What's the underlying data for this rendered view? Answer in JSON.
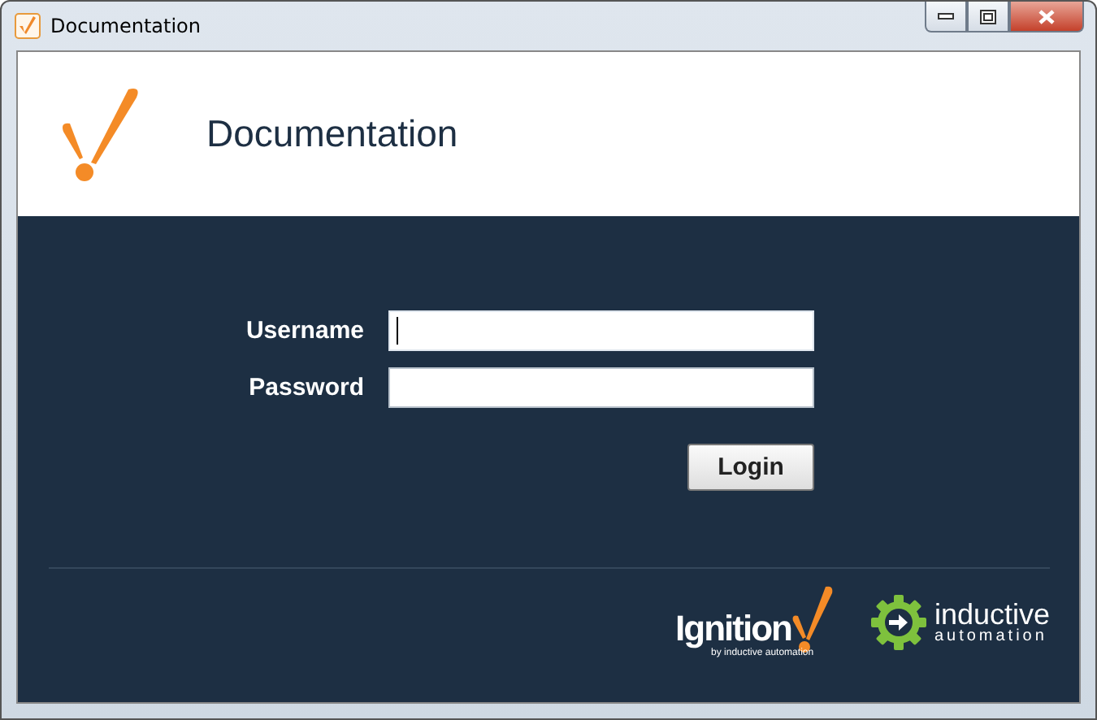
{
  "window": {
    "title": "Documentation"
  },
  "header": {
    "title": "Documentation"
  },
  "form": {
    "fields": [
      {
        "label": "Username",
        "focused": true
      },
      {
        "label": "Password",
        "focused": false
      }
    ],
    "button": "Login"
  },
  "footer": {
    "ignition": {
      "name": "Ignition",
      "tagline": "by inductive automation"
    },
    "company": {
      "line1": "inductive",
      "line2": "automation"
    }
  }
}
